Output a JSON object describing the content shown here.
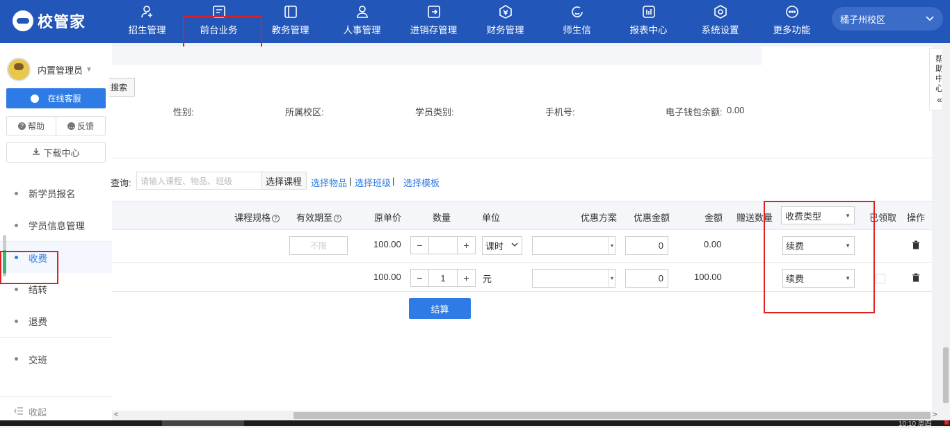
{
  "app": {
    "logo_text": "校管家",
    "campus": "橘子州校区"
  },
  "nav": [
    {
      "label": "招生管理",
      "icon": "person-add-icon"
    },
    {
      "label": "前台业务",
      "icon": "desk-icon"
    },
    {
      "label": "教务管理",
      "icon": "book-icon"
    },
    {
      "label": "人事管理",
      "icon": "person-icon"
    },
    {
      "label": "进销存管理",
      "icon": "inventory-icon"
    },
    {
      "label": "财务管理",
      "icon": "finance-icon"
    },
    {
      "label": "师生信",
      "icon": "message-icon"
    },
    {
      "label": "报表中心",
      "icon": "report-icon"
    },
    {
      "label": "系统设置",
      "icon": "settings-icon"
    },
    {
      "label": "更多功能",
      "icon": "more-icon"
    }
  ],
  "sidebar": {
    "user_name": "内置管理员",
    "service_button": "在线客服",
    "help_label": "帮助",
    "feedback_label": "反馈",
    "download_label": "下载中心",
    "menu": [
      "新学员报名",
      "学员信息管理",
      "收费",
      "结转",
      "退费",
      "交班"
    ],
    "collapse_label": "收起"
  },
  "main": {
    "search_button": "搜索",
    "info": {
      "gender": "性别:",
      "campus": "所属校区:",
      "student_type": "学员类别:",
      "phone": "手机号:",
      "wallet": "电子钱包余额:",
      "wallet_value": "0.00"
    },
    "query_label": "查询:",
    "query_placeholder": "请输入课程、物品、班级",
    "select_course": "选择课程",
    "select_item": "选择物品",
    "select_class": "选择班级",
    "select_template": "选择模板",
    "separator": "|",
    "columns": {
      "spec": "课程规格",
      "valid_until": "有效期至",
      "unit_price": "原单价",
      "quantity": "数量",
      "unit": "单位",
      "discount_plan": "优惠方案",
      "discount_amount": "优惠金额",
      "amount": "金额",
      "gift_qty": "赠送数量",
      "charge_type": "收费类型",
      "received": "已领取",
      "action": "操作"
    },
    "rows": [
      {
        "valid_placeholder": "不限",
        "unit_price": "100.00",
        "quantity": "",
        "unit": "课时",
        "discount_amount": "0",
        "amount": "0.00",
        "charge_type": "续费"
      },
      {
        "unit_price": "100.00",
        "quantity": "1",
        "unit": "元",
        "discount_amount": "0",
        "amount": "100.00",
        "charge_type": "续费"
      }
    ],
    "submit": "结算",
    "minus": "−",
    "plus": "+"
  },
  "help_center": [
    "帮",
    "助",
    "中",
    "心"
  ],
  "taskbar": {
    "clock": "10:10 周四"
  }
}
